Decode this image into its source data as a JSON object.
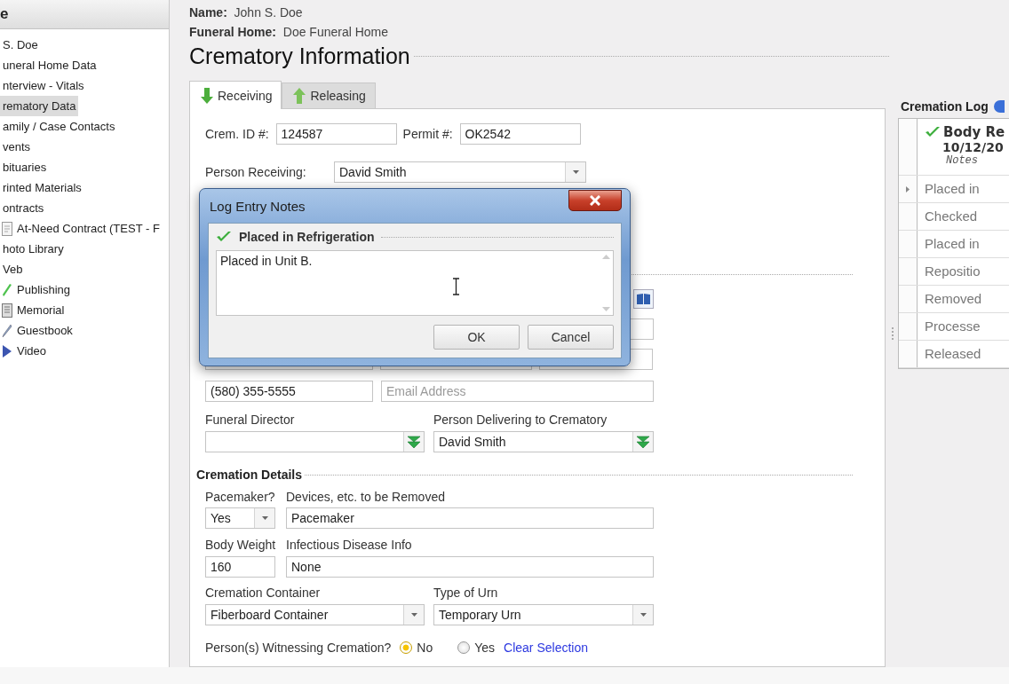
{
  "sidebar": {
    "title": "e",
    "items": [
      {
        "label": "S. Doe",
        "selected": false
      },
      {
        "label": "uneral Home Data",
        "selected": false
      },
      {
        "label": "nterview - Vitals",
        "selected": false
      },
      {
        "label": "rematory Data",
        "selected": true
      },
      {
        "label": "amily / Case Contacts",
        "selected": false
      },
      {
        "label": "vents",
        "selected": false
      },
      {
        "label": "bituaries",
        "selected": false
      },
      {
        "label": "rinted Materials",
        "selected": false
      },
      {
        "label": "ontracts",
        "selected": false,
        "children": [
          {
            "label": "At-Need Contract (TEST - F",
            "selected": false,
            "kind": "document"
          }
        ]
      },
      {
        "label": "hoto Library",
        "selected": false
      },
      {
        "label": "Veb",
        "selected": false,
        "children": [
          {
            "label": "Publishing",
            "selected": false,
            "kind": "pen"
          },
          {
            "label": "Memorial",
            "selected": false,
            "kind": "page"
          },
          {
            "label": "Guestbook",
            "selected": false,
            "kind": "quill"
          },
          {
            "label": "Video",
            "selected": false,
            "kind": "video"
          }
        ]
      }
    ]
  },
  "header": {
    "name_label": "Name:",
    "name": "John S. Doe",
    "home_label": "Funeral Home:",
    "home": "Doe Funeral Home",
    "title": "Crematory Information"
  },
  "tabs": [
    {
      "label": "Receiving",
      "selected": true,
      "kind": "down"
    },
    {
      "label": "Releasing",
      "selected": false,
      "kind": "up"
    }
  ],
  "form": {
    "crem_id_label": "Crem. ID #:",
    "crem_id": "124587",
    "permit_label": "Permit #:",
    "permit": "OK2542",
    "person_receiving_label": "Person Receiving:",
    "person_receiving": "David Smith",
    "phone": "(580) 355-5555",
    "email_placeholder": "Email Address",
    "funeral_director_label": "Funeral Director",
    "person_delivering_label": "Person Delivering to Crematory",
    "person_delivering": "David Smith"
  },
  "cremation_details": {
    "title": "Cremation Details",
    "pacemaker_label": "Pacemaker?",
    "pacemaker": "Yes",
    "devices_label": "Devices, etc. to be Removed",
    "devices": "Pacemaker",
    "weight_label": "Body Weight",
    "weight": "160",
    "disease_label": "Infectious Disease Info",
    "disease": "None",
    "container_label": "Cremation Container",
    "container": "Fiberboard Container",
    "urn_label": "Type of Urn",
    "urn": "Temporary Urn",
    "witness_label": "Person(s) Witnessing Cremation?",
    "witness_options": [
      {
        "label": "No",
        "selected": true
      },
      {
        "label": "Yes",
        "selected": false
      }
    ],
    "clear_link": "Clear Selection"
  },
  "dialog": {
    "title": "Log Entry Notes",
    "entry": "Placed in Refrigeration",
    "notes": "Placed in Unit B.",
    "buttons": [
      "OK",
      "Cancel"
    ]
  },
  "cremation_log": {
    "title": "Cremation Log",
    "header": {
      "event": "Body Re",
      "date": "10/12/20",
      "notes": "Notes"
    },
    "rows": [
      {
        "text": "Placed in",
        "current": true
      },
      {
        "text": "Checked",
        "current": false
      },
      {
        "text": "Placed in",
        "current": false
      },
      {
        "text": "Repositio",
        "current": false
      },
      {
        "text": "Removed",
        "current": false
      },
      {
        "text": "Processe",
        "current": false
      },
      {
        "text": "Released",
        "current": false
      }
    ]
  }
}
